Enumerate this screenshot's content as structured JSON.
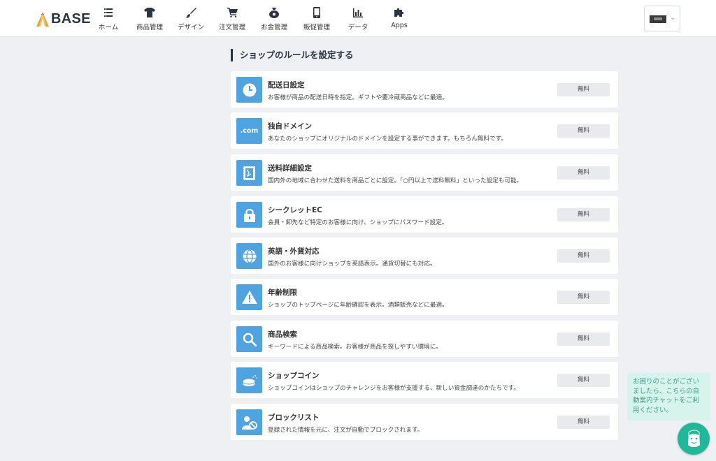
{
  "brand": {
    "name": "BASE"
  },
  "nav": [
    {
      "label": "ホーム",
      "icon": "list-icon"
    },
    {
      "label": "商品管理",
      "icon": "tshirt-icon"
    },
    {
      "label": "デザイン",
      "icon": "brush-icon"
    },
    {
      "label": "注文管理",
      "icon": "cart-icon"
    },
    {
      "label": "お金管理",
      "icon": "money-bag-icon"
    },
    {
      "label": "販促管理",
      "icon": "smartphone-icon"
    },
    {
      "label": "データ",
      "icon": "bar-chart-icon"
    },
    {
      "label": "Apps",
      "icon": "puzzle-icon"
    }
  ],
  "section_title": "ショップのルールを設定する",
  "apps": [
    {
      "title": "配送日設定",
      "desc": "お客様が商品の配送日時を指定。ギフトや要冷蔵商品などに最適。",
      "price": "無料",
      "icon": "clock-icon"
    },
    {
      "title": "独自ドメイン",
      "desc": "あなたのショップにオリジナルのドメインを設定する事ができます。もちろん無料です。",
      "price": "無料",
      "icon": "dotcom-icon",
      "icon_text": ".com"
    },
    {
      "title": "送料詳細設定",
      "desc": "国内外の地域に合わせた送料を商品ごとに設定。「○円以上で送料無料」といった設定も可能。",
      "price": "無料",
      "icon": "stamp-icon"
    },
    {
      "title": "シークレットEC",
      "desc": "会員・卸先など特定のお客様に向け、ショップにパスワード設定。",
      "price": "無料",
      "icon": "lock-icon"
    },
    {
      "title": "英語・外貨対応",
      "desc": "国外のお客様に向けショップを英語表示。通貨切替にも対応。",
      "price": "無料",
      "icon": "globe-icon"
    },
    {
      "title": "年齢制限",
      "desc": "ショップのトップページに年齢確認を表示。酒類販売などに最適。",
      "price": "無料",
      "icon": "warning-icon"
    },
    {
      "title": "商品検索",
      "desc": "キーワードによる商品検索。お客様が商品を探しやすい環境に。",
      "price": "無料",
      "icon": "search-icon"
    },
    {
      "title": "ショップコイン",
      "desc": "ショップコインはショップのチャレンジをお客様が支援する、新しい資金調達のかたちです。",
      "price": "無料",
      "icon": "coin-icon"
    },
    {
      "title": "ブロックリスト",
      "desc": "登録された情報を元に、注文が自動でブロックされます。",
      "price": "無料",
      "icon": "block-user-icon"
    }
  ],
  "chat": {
    "message": "お困りのことがございましたら、こちらの自動案内チャットをご利用ください。"
  },
  "colors": {
    "accent": "#4fa3e0",
    "chat": "#1fb89a",
    "chat_bg": "#d7f4ec",
    "text_dark": "#2b3442"
  }
}
